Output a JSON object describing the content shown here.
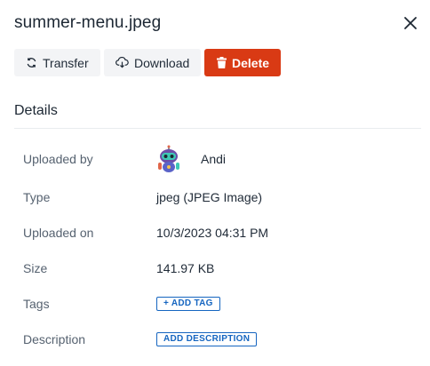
{
  "header": {
    "title": "summer-menu.jpeg",
    "close_icon": "close-icon"
  },
  "toolbar": {
    "transfer_label": "Transfer",
    "transfer_icon": "refresh-icon",
    "download_label": "Download",
    "download_icon": "cloud-download-icon",
    "delete_label": "Delete",
    "delete_icon": "trash-icon",
    "delete_color": "#d93a14"
  },
  "details": {
    "section_title": "Details",
    "uploaded_by": {
      "label": "Uploaded by",
      "value": "Andi",
      "avatar_icon": "robot-avatar-icon"
    },
    "type": {
      "label": "Type",
      "value": "jpeg (JPEG Image)"
    },
    "uploaded_on": {
      "label": "Uploaded on",
      "value": "10/3/2023 04:31 PM"
    },
    "size": {
      "label": "Size",
      "value": "141.97 KB"
    },
    "tags": {
      "label": "Tags",
      "action": "+ ADD TAG"
    },
    "description": {
      "label": "Description",
      "action": "ADD DESCRIPTION"
    },
    "accent_color": "#1565c0"
  }
}
